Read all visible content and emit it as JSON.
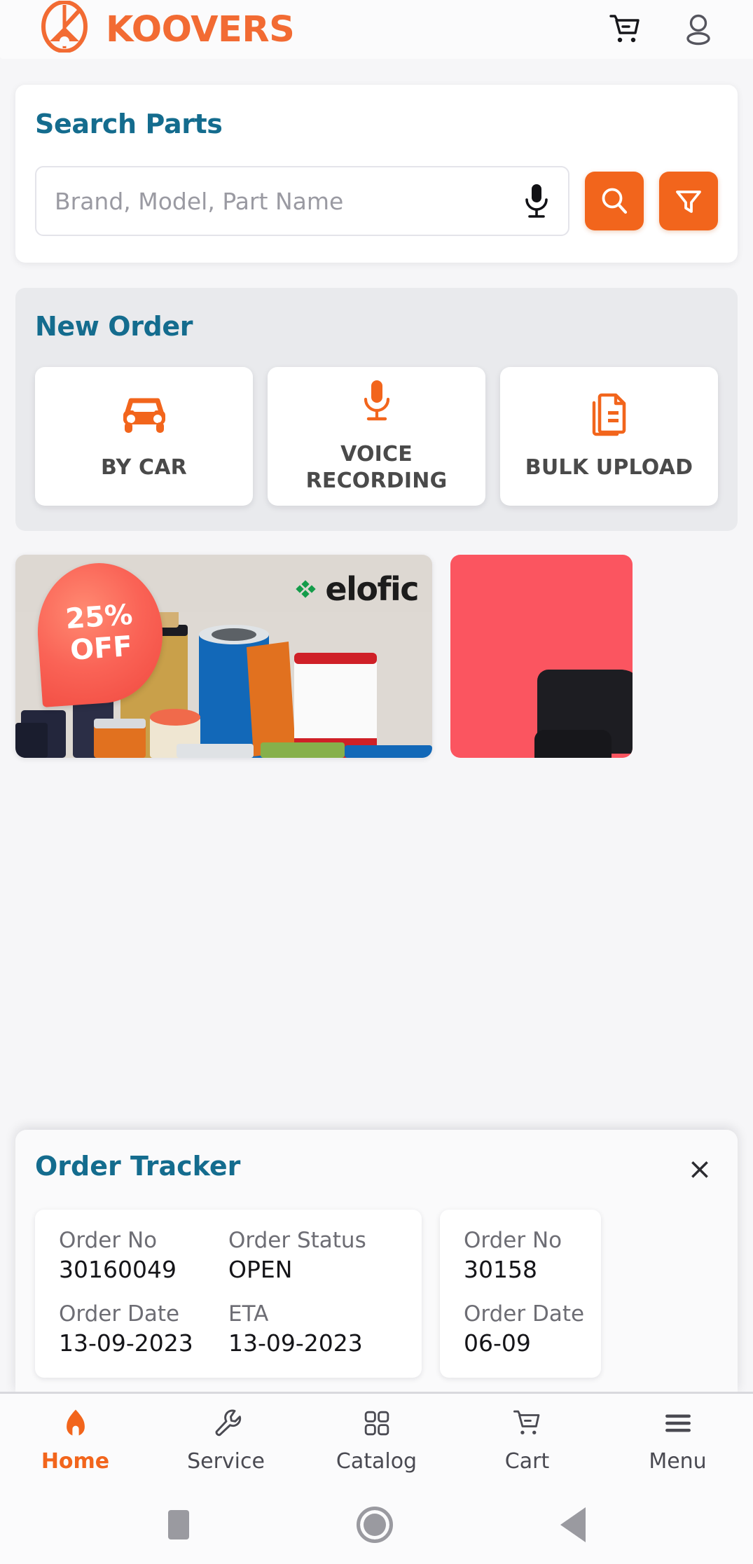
{
  "header": {
    "brand_name": "KOOVERS",
    "logo_icon": "koovers-logo-icon",
    "cart_icon": "cart-icon",
    "account_icon": "user-account-icon"
  },
  "search": {
    "title": "Search Parts",
    "placeholder": "Brand, Model, Part Name",
    "value": "",
    "mic_icon": "microphone-icon",
    "search_icon": "search-icon",
    "filter_icon": "filter-funnel-icon"
  },
  "new_order": {
    "title": "New Order",
    "tiles": [
      {
        "label": "BY CAR",
        "icon": "car-icon"
      },
      {
        "label": "VOICE RECORDING",
        "icon": "microphone-icon"
      },
      {
        "label": "BULK UPLOAD",
        "icon": "document-upload-icon"
      }
    ]
  },
  "banners": [
    {
      "discount": "25%",
      "discount_sub": "OFF",
      "brand": "elofic",
      "alt": "auto filters promotional banner"
    },
    {
      "alt": "red promotional banner"
    }
  ],
  "order_tracker": {
    "title": "Order Tracker",
    "close_label": "×",
    "labels": {
      "order_no": "Order No",
      "order_status": "Order Status",
      "order_date": "Order Date",
      "eta": "ETA"
    },
    "orders": [
      {
        "order_no": "30160049",
        "order_status": "OPEN",
        "order_date": "13-09-2023",
        "eta": "13-09-2023"
      },
      {
        "order_no": "30158",
        "order_date": "06-09"
      }
    ]
  },
  "bottom_nav": [
    {
      "label": "Home",
      "icon": "home-icon",
      "active": true
    },
    {
      "label": "Service",
      "icon": "wrench-icon",
      "active": false
    },
    {
      "label": "Catalog",
      "icon": "grid-icon",
      "active": false
    },
    {
      "label": "Cart",
      "icon": "cart-icon",
      "active": false
    },
    {
      "label": "Menu",
      "icon": "hamburger-menu-icon",
      "active": false
    }
  ],
  "system_bar": {
    "recents_icon": "square-recents-icon",
    "home_icon": "circle-home-icon",
    "back_icon": "triangle-back-icon"
  },
  "colors": {
    "accent_orange": "#F2651C",
    "brand_orange": "#F26B33",
    "title_teal": "#146C8E",
    "page_bg": "#f6f6f8"
  }
}
